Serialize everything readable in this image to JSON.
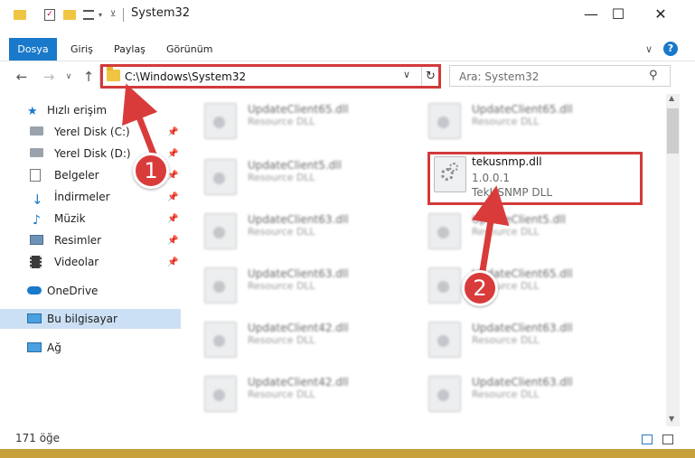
{
  "window": {
    "title": "System32",
    "controls": {
      "minimize": "—",
      "maximize": "☐",
      "close": "✕"
    }
  },
  "ribbon": {
    "tabs": [
      {
        "label": "Dosya",
        "active": true
      },
      {
        "label": "Giriş"
      },
      {
        "label": "Paylaş"
      },
      {
        "label": "Görünüm"
      }
    ],
    "collapse_icon": "chevron-down",
    "help_icon": "?"
  },
  "address_bar": {
    "path": "C:\\Windows\\System32",
    "dropdown": "∨",
    "refresh": "↻"
  },
  "search": {
    "placeholder": "Ara: System32",
    "icon": "⚲"
  },
  "nav": {
    "back": "←",
    "forward": "→",
    "recent": "∨",
    "up": "↑"
  },
  "sidebar": {
    "items": [
      {
        "label": "Hızlı erişim",
        "icon": "star-icon"
      },
      {
        "label": "Yerel Disk (C:)",
        "icon": "drive-icon",
        "pinned": true
      },
      {
        "label": "Yerel Disk (D:)",
        "icon": "drive-icon",
        "pinned": true
      },
      {
        "label": "Belgeler",
        "icon": "documents-icon",
        "pinned": true
      },
      {
        "label": "İndirmeler",
        "icon": "download-icon",
        "pinned": true
      },
      {
        "label": "Müzik",
        "icon": "music-icon",
        "pinned": true
      },
      {
        "label": "Resimler",
        "icon": "pictures-icon",
        "pinned": true
      },
      {
        "label": "Videolar",
        "icon": "video-icon",
        "pinned": true
      },
      {
        "label": "OneDrive",
        "icon": "cloud-icon"
      },
      {
        "label": "Bu bilgisayar",
        "icon": "computer-icon",
        "selected": true
      },
      {
        "label": "Ağ",
        "icon": "network-icon"
      }
    ]
  },
  "files": [
    {
      "name": "UpdateClient65.dll",
      "desc": "Resource DLL"
    },
    {
      "name": "UpdateClient65.dll",
      "desc": "Resource DLL"
    },
    {
      "name": "UpdateClient5.dll",
      "desc": "Resource DLL"
    },
    {
      "name": "UpdateClient63.dll",
      "desc": "Resource DLL"
    },
    {
      "name": "UpdateClient5.dll",
      "desc": "Resource DLL"
    },
    {
      "name": "UpdateClient63.dll",
      "desc": "Resource DLL"
    },
    {
      "name": "UpdateClient65.dll",
      "desc": "Resource DLL"
    },
    {
      "name": "UpdateClient42.dll",
      "desc": "Resource DLL"
    },
    {
      "name": "UpdateClient63.dll",
      "desc": "Resource DLL"
    },
    {
      "name": "UpdateClient42.dll",
      "desc": "Resource DLL"
    },
    {
      "name": "UpdateClient63.dll",
      "desc": "Resource DLL"
    }
  ],
  "target_file": {
    "name": "tekusnmp.dll",
    "version": "1.0.0.1",
    "desc": "TekUSNMP DLL"
  },
  "status": {
    "item_count": "171 öğe"
  },
  "callouts": {
    "step1": "1",
    "step2": "2"
  },
  "colors": {
    "accent": "#1979ca",
    "highlight": "#d23a3a",
    "selection": "#cce0f5"
  }
}
